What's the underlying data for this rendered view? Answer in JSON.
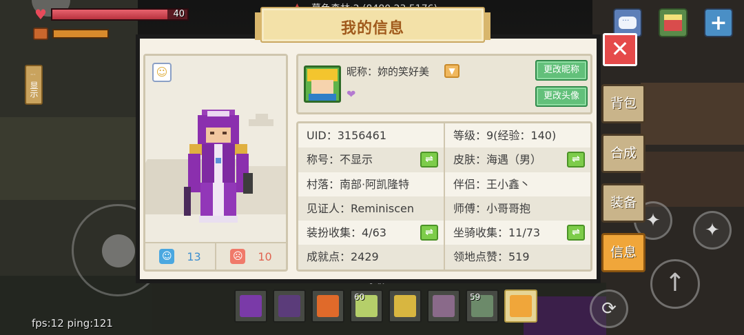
{
  "hud": {
    "location": "幕色森林:2 (8480,23,5176)",
    "hp_value": "40",
    "hp_fraction": 0.85,
    "food_fraction": 1.0,
    "show_label": "显示",
    "fps_text": "fps:12 ping:121",
    "level_text": "等级: 9"
  },
  "title": "我的信息",
  "close_label": "✕",
  "side_tabs": [
    {
      "label": "背包"
    },
    {
      "label": "合成"
    },
    {
      "label": "装备"
    },
    {
      "label": "信息"
    }
  ],
  "card": {
    "like_count": "13",
    "dislike_count": "10"
  },
  "profile": {
    "nickname": "昵称：妳的笑好美",
    "change_nick": "更改昵称",
    "change_avatar": "更改头像"
  },
  "info": {
    "uid": "UID：3156461",
    "level": "等级：9(经验：140)",
    "title": "称号：不显示",
    "skin": "皮肤：海遇（男）",
    "village": "村落：南部·阿凯隆特",
    "partner": "伴侣：王小鑫丶",
    "witness": "见证人：Reminiscen",
    "master": "师傅：小哥哥抱",
    "dress": "装扮收集：4/63",
    "mount": "坐骑收集：11/73",
    "achievement": "成就点：2429",
    "territory": "领地点赞：519"
  },
  "hotbar": [
    {
      "count": "",
      "color": "#7a3aa8"
    },
    {
      "count": "",
      "color": "#5b3c7a"
    },
    {
      "count": "",
      "color": "#e06a2a"
    },
    {
      "count": "60",
      "color": "#b5cf6a"
    },
    {
      "count": "",
      "color": "#d8b640"
    },
    {
      "count": "",
      "color": "#8a6a8a"
    },
    {
      "count": "59",
      "color": "#6c8a6a"
    },
    {
      "count": "",
      "color": "#f0a63a"
    }
  ],
  "colors": {
    "accent_orange": "#f0a63a",
    "green_button": "#62c07a",
    "close_red": "#e54a4a"
  }
}
